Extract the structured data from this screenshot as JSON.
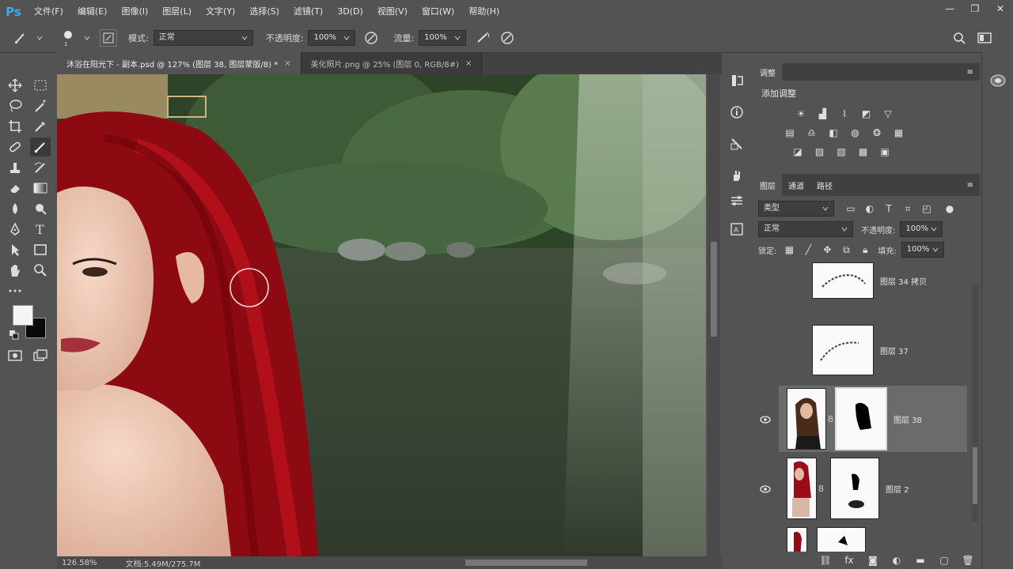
{
  "app": {
    "logo": "Ps"
  },
  "menu": [
    "文件(F)",
    "编辑(E)",
    "图像(I)",
    "图层(L)",
    "文字(Y)",
    "选择(S)",
    "滤镜(T)",
    "3D(D)",
    "视图(V)",
    "窗口(W)",
    "帮助(H)"
  ],
  "window_controls": {
    "minimize": "—",
    "restore": "❐",
    "close": "✕"
  },
  "options": {
    "mode_label": "模式:",
    "mode_value": "正常",
    "opacity_label": "不透明度:",
    "opacity_value": "100%",
    "flow_label": "流量:",
    "flow_value": "100%"
  },
  "tabs": [
    {
      "label": "沐浴在阳光下 - 副本.psd @ 127% (图层 38, 图层蒙版/8) *",
      "close": "×"
    },
    {
      "label": "美化照片.png @ 25% (图层 0, RGB/8#)",
      "close": "×"
    }
  ],
  "status": {
    "zoom": "126.58%",
    "doc": "文档:5.49M/275.7M"
  },
  "adjustments": {
    "tab": "调整",
    "title": "添加调整"
  },
  "layers_panel": {
    "tabs": [
      "图层",
      "通道",
      "路径"
    ],
    "filter": "类型",
    "blend_mode": "正常",
    "opacity_label": "不透明度:",
    "opacity_value": "100%",
    "lock_label": "锁定:",
    "fill_label": "填充:",
    "fill_value": "100%",
    "layers": [
      {
        "name": "图层 34 拷贝",
        "visible": false
      },
      {
        "name": "图层 37",
        "visible": false
      },
      {
        "name": "图层 38",
        "visible": true,
        "selected": true
      },
      {
        "name": "图层 2",
        "visible": true
      },
      {
        "name": "",
        "visible": false
      }
    ]
  },
  "colors": {
    "bg": "#535353",
    "dark": "#3c3c3c",
    "selected_layer": "#6b6b6b",
    "accent": "#3fa9f5",
    "hair": "#b3101a"
  }
}
